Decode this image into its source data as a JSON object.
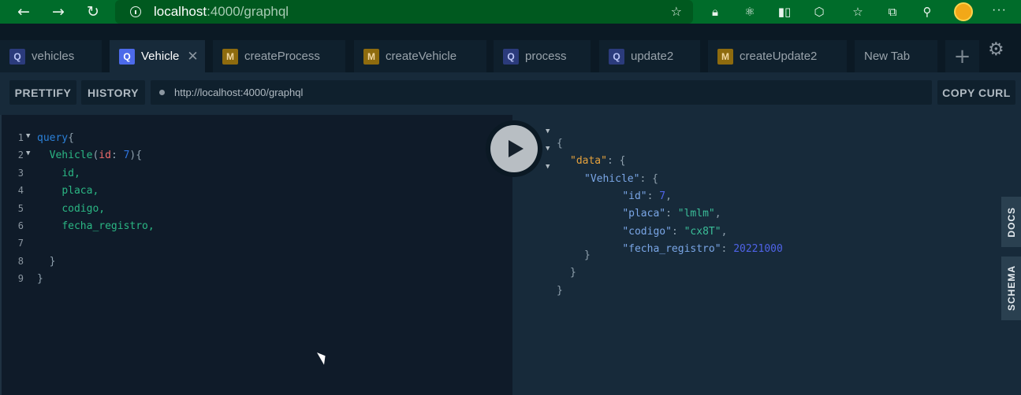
{
  "browser": {
    "url_host": "localhost",
    "url_rest": ":4000/graphql",
    "icons": [
      "back-icon",
      "forward-icon",
      "refresh-icon",
      "info-icon",
      "add-favorite-icon",
      "lock-icon",
      "react-icon",
      "window-icon",
      "puzzle-icon",
      "favorites-icon",
      "collections-icon",
      "share-icon",
      "profile-icon",
      "more-icon"
    ]
  },
  "tabs": [
    {
      "badge": "Q",
      "label": "vehicles"
    },
    {
      "badge": "Q",
      "label": "Vehicle"
    },
    {
      "badge": "M",
      "label": "createProcess"
    },
    {
      "badge": "M",
      "label": "createVehicle"
    },
    {
      "badge": "Q",
      "label": "process"
    },
    {
      "badge": "Q",
      "label": "update2"
    },
    {
      "badge": "M",
      "label": "createUpdate2"
    },
    {
      "badge": "",
      "label": "New Tab"
    }
  ],
  "toolbar": {
    "prettify": "PRETTIFY",
    "history": "HISTORY",
    "endpoint": "http://localhost:4000/graphql",
    "copy_curl": "COPY CURL"
  },
  "editor": {
    "line_numbers": [
      "1",
      "2",
      "3",
      "4",
      "5",
      "6",
      "7",
      "8",
      "9"
    ],
    "query_kw": "query",
    "open_brace": "{",
    "field_name": "Vehicle",
    "arg_name": "id",
    "arg_value": "7",
    "fields": [
      "id,",
      "placa,",
      "codigo,",
      "fecha_registro,"
    ],
    "close_brace": "}"
  },
  "results": {
    "data_key": "\"data\"",
    "vehicle_key": "\"Vehicle\"",
    "id_key": "\"id\"",
    "id_value": "7",
    "placa_key": "\"placa\"",
    "placa_value": "\"lmlm\"",
    "codigo_key": "\"codigo\"",
    "codigo_value": "\"cx8T\"",
    "fecha_key": "\"fecha_registro\"",
    "fecha_value": "20221000"
  },
  "side_tabs": {
    "docs": "DOCS",
    "schema": "SCHEMA"
  },
  "colors": {
    "browser_bar": "#006c2a",
    "query_badge": "#4c6aea",
    "mutation_badge": "#8e6b0e",
    "editor_bg": "#0f1b29",
    "results_bg": "#172a3a"
  }
}
